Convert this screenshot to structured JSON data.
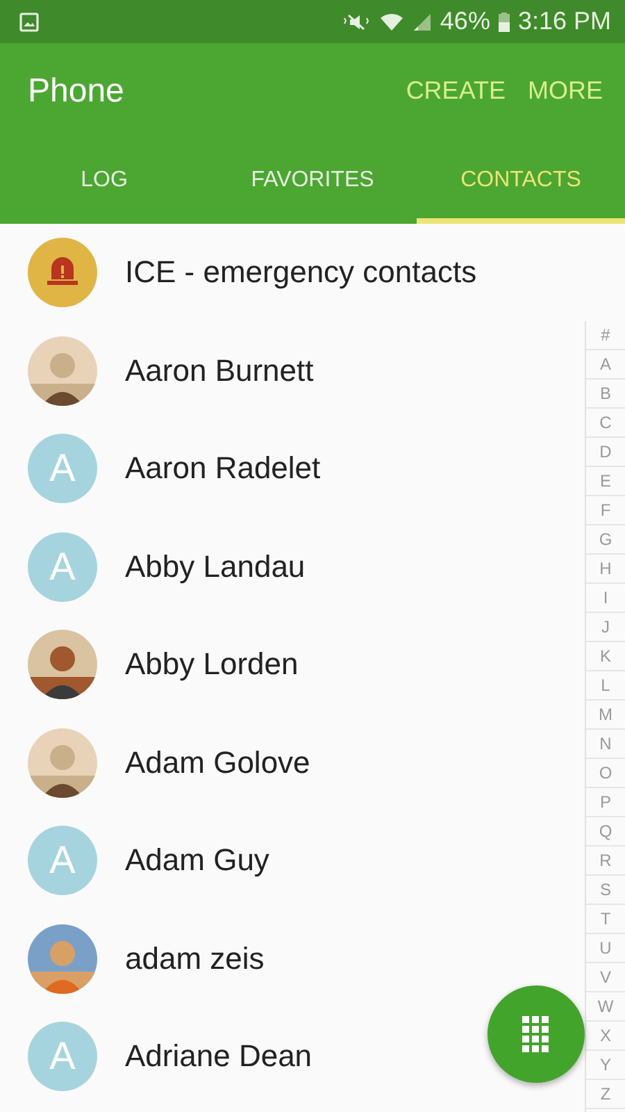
{
  "status_bar": {
    "battery": "46%",
    "time": "3:16 PM"
  },
  "app_bar": {
    "title": "Phone",
    "actions": [
      "CREATE",
      "MORE"
    ]
  },
  "tabs": [
    {
      "label": "LOG",
      "selected": false
    },
    {
      "label": "FAVORITES",
      "selected": false
    },
    {
      "label": "CONTACTS",
      "selected": true
    }
  ],
  "ice": {
    "label": "ICE - emergency contacts"
  },
  "contacts": [
    {
      "name": "Aaron Burnett"
    },
    {
      "name": "Aaron Radelet",
      "avatar": {
        "kind": "letter",
        "letter": "A"
      }
    },
    {
      "name": "Abby Landau",
      "avatar": {
        "kind": "letter",
        "letter": "A"
      }
    },
    {
      "name": "Abby Lorden"
    },
    {
      "name": "Adam Golove"
    },
    {
      "name": "Adam Guy",
      "avatar": {
        "kind": "letter",
        "letter": "A"
      }
    },
    {
      "name": "adam zeis"
    },
    {
      "name": "Adriane Dean",
      "avatar": {
        "kind": "letter",
        "letter": "A"
      }
    }
  ],
  "index": [
    "#",
    "A",
    "B",
    "C",
    "D",
    "E",
    "F",
    "G",
    "H",
    "I",
    "J",
    "K",
    "L",
    "M",
    "N",
    "O",
    "P",
    "Q",
    "R",
    "S",
    "T",
    "U",
    "V",
    "W",
    "X",
    "Y",
    "Z"
  ]
}
